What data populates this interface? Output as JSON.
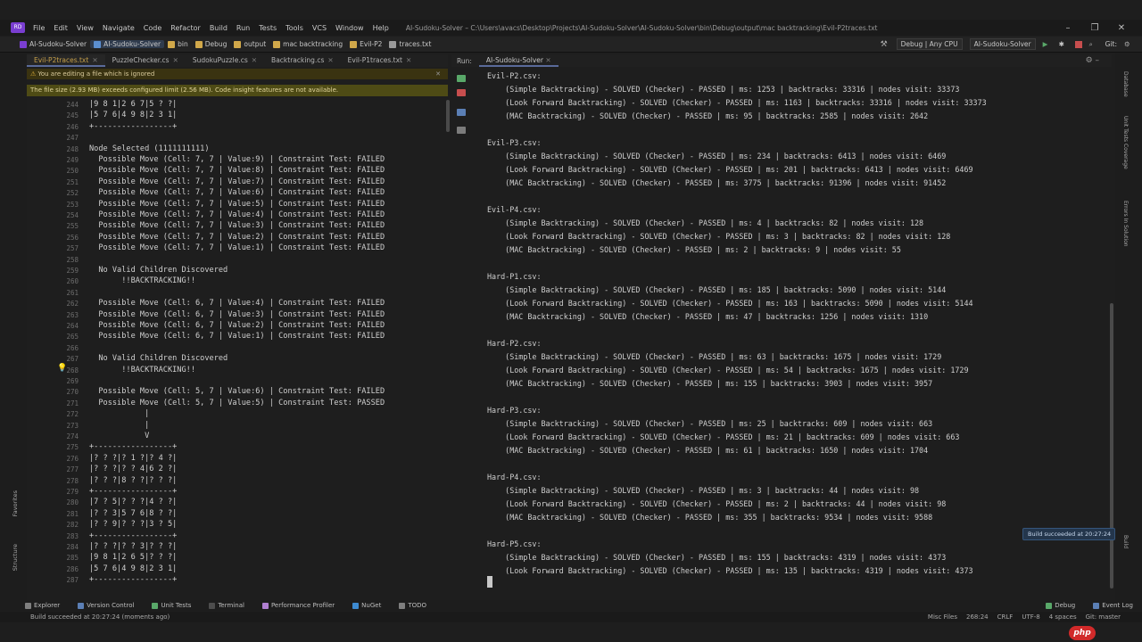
{
  "titlebar": {
    "menus": [
      "File",
      "Edit",
      "View",
      "Navigate",
      "Code",
      "Refactor",
      "Build",
      "Run",
      "Tests",
      "Tools",
      "VCS",
      "Window",
      "Help"
    ],
    "title": "AI-Sudoku-Solver – C:\\Users\\avacs\\Desktop\\Projects\\AI-Sudoku-Solver\\AI-Sudoku-Solver\\bin\\Debug\\output\\mac backtracking\\Evil-P2traces.txt"
  },
  "navbar": {
    "breadcrumbs": [
      "AI-Sudoku-Solver",
      "AI-Sudoku-Solver",
      "bin",
      "Debug",
      "output",
      "mac backtracking",
      "Evil-P2",
      "traces.txt"
    ],
    "config": "Debug | Any CPU",
    "project": "AI-Sudoku-Solver",
    "git": "Git:"
  },
  "editor_tabs": [
    {
      "label": "Evil-P2traces.txt",
      "active": true
    },
    {
      "label": "PuzzleChecker.cs",
      "active": false
    },
    {
      "label": "SudokuPuzzle.cs",
      "active": false
    },
    {
      "label": "Backtracking.cs",
      "active": false
    },
    {
      "label": "Evil-P1traces.txt",
      "active": false
    }
  ],
  "warnings": {
    "ignored": "You are editing a file which is ignored",
    "size": "The file size (2.93 MB) exceeds configured limit (2.56 MB). Code insight features are not available."
  },
  "editor_lines": [
    {
      "n": "244",
      "t": "|9 8 1|2 6 7|5 ? ?|"
    },
    {
      "n": "245",
      "t": "|5 7 6|4 9 8|2 3 1|"
    },
    {
      "n": "246",
      "t": "+-----------------+"
    },
    {
      "n": "247",
      "t": ""
    },
    {
      "n": "248",
      "t": "Node Selected (1111111111)"
    },
    {
      "n": "249",
      "t": "  Possible Move (Cell: 7, 7 | Value:9) | Constraint Test: FAILED"
    },
    {
      "n": "250",
      "t": "  Possible Move (Cell: 7, 7 | Value:8) | Constraint Test: FAILED"
    },
    {
      "n": "251",
      "t": "  Possible Move (Cell: 7, 7 | Value:7) | Constraint Test: FAILED"
    },
    {
      "n": "252",
      "t": "  Possible Move (Cell: 7, 7 | Value:6) | Constraint Test: FAILED"
    },
    {
      "n": "253",
      "t": "  Possible Move (Cell: 7, 7 | Value:5) | Constraint Test: FAILED"
    },
    {
      "n": "254",
      "t": "  Possible Move (Cell: 7, 7 | Value:4) | Constraint Test: FAILED"
    },
    {
      "n": "255",
      "t": "  Possible Move (Cell: 7, 7 | Value:3) | Constraint Test: FAILED"
    },
    {
      "n": "256",
      "t": "  Possible Move (Cell: 7, 7 | Value:2) | Constraint Test: FAILED"
    },
    {
      "n": "257",
      "t": "  Possible Move (Cell: 7, 7 | Value:1) | Constraint Test: FAILED"
    },
    {
      "n": "258",
      "t": ""
    },
    {
      "n": "259",
      "t": "  No Valid Children Discovered"
    },
    {
      "n": "260",
      "t": "       !!BACKTRACKING!!"
    },
    {
      "n": "261",
      "t": ""
    },
    {
      "n": "262",
      "t": "  Possible Move (Cell: 6, 7 | Value:4) | Constraint Test: FAILED"
    },
    {
      "n": "263",
      "t": "  Possible Move (Cell: 6, 7 | Value:3) | Constraint Test: FAILED"
    },
    {
      "n": "264",
      "t": "  Possible Move (Cell: 6, 7 | Value:2) | Constraint Test: FAILED"
    },
    {
      "n": "265",
      "t": "  Possible Move (Cell: 6, 7 | Value:1) | Constraint Test: FAILED"
    },
    {
      "n": "266",
      "t": ""
    },
    {
      "n": "267",
      "t": "  No Valid Children Discovered"
    },
    {
      "n": "268",
      "t": "       !!BACKTRACKING!!"
    },
    {
      "n": "269",
      "t": ""
    },
    {
      "n": "270",
      "t": "  Possible Move (Cell: 5, 7 | Value:6) | Constraint Test: FAILED"
    },
    {
      "n": "271",
      "t": "  Possible Move (Cell: 5, 7 | Value:5) | Constraint Test: PASSED"
    },
    {
      "n": "272",
      "t": "            |"
    },
    {
      "n": "273",
      "t": "            |"
    },
    {
      "n": "274",
      "t": "            V"
    },
    {
      "n": "275",
      "t": "+-----------------+"
    },
    {
      "n": "276",
      "t": "|? ? ?|? 1 ?|? 4 ?|"
    },
    {
      "n": "277",
      "t": "|? ? ?|? ? 4|6 2 ?|"
    },
    {
      "n": "278",
      "t": "|? ? ?|8 ? ?|? ? ?|"
    },
    {
      "n": "279",
      "t": "+-----------------+"
    },
    {
      "n": "280",
      "t": "|7 ? 5|? ? ?|4 ? ?|"
    },
    {
      "n": "281",
      "t": "|? ? 3|5 7 6|8 ? ?|"
    },
    {
      "n": "282",
      "t": "|? ? 9|? ? ?|3 ? 5|"
    },
    {
      "n": "283",
      "t": "+-----------------+"
    },
    {
      "n": "284",
      "t": "|? ? ?|? ? 3|? ? ?|"
    },
    {
      "n": "285",
      "t": "|9 8 1|2 6 5|? ? ?|"
    },
    {
      "n": "286",
      "t": "|5 7 6|4 9 8|2 3 1|"
    },
    {
      "n": "287",
      "t": "+-----------------+"
    }
  ],
  "run_panel": {
    "label": "Run:",
    "tab": "AI-Sudoku-Solver"
  },
  "console_lines": [
    "Evil-P2.csv:",
    "    (Simple Backtracking) - SOLVED (Checker) - PASSED | ms: 1253 | backtracks: 33316 | nodes visit: 33373",
    "    (Look Forward Backtracking) - SOLVED (Checker) - PASSED | ms: 1163 | backtracks: 33316 | nodes visit: 33373",
    "    (MAC Backtracking) - SOLVED (Checker) - PASSED | ms: 95 | backtracks: 2585 | nodes visit: 2642",
    "",
    "Evil-P3.csv:",
    "    (Simple Backtracking) - SOLVED (Checker) - PASSED | ms: 234 | backtracks: 6413 | nodes visit: 6469",
    "    (Look Forward Backtracking) - SOLVED (Checker) - PASSED | ms: 201 | backtracks: 6413 | nodes visit: 6469",
    "    (MAC Backtracking) - SOLVED (Checker) - PASSED | ms: 3775 | backtracks: 91396 | nodes visit: 91452",
    "",
    "Evil-P4.csv:",
    "    (Simple Backtracking) - SOLVED (Checker) - PASSED | ms: 4 | backtracks: 82 | nodes visit: 128",
    "    (Look Forward Backtracking) - SOLVED (Checker) - PASSED | ms: 3 | backtracks: 82 | nodes visit: 128",
    "    (MAC Backtracking) - SOLVED (Checker) - PASSED | ms: 2 | backtracks: 9 | nodes visit: 55",
    "",
    "Hard-P1.csv:",
    "    (Simple Backtracking) - SOLVED (Checker) - PASSED | ms: 185 | backtracks: 5090 | nodes visit: 5144",
    "    (Look Forward Backtracking) - SOLVED (Checker) - PASSED | ms: 163 | backtracks: 5090 | nodes visit: 5144",
    "    (MAC Backtracking) - SOLVED (Checker) - PASSED | ms: 47 | backtracks: 1256 | nodes visit: 1310",
    "",
    "Hard-P2.csv:",
    "    (Simple Backtracking) - SOLVED (Checker) - PASSED | ms: 63 | backtracks: 1675 | nodes visit: 1729",
    "    (Look Forward Backtracking) - SOLVED (Checker) - PASSED | ms: 54 | backtracks: 1675 | nodes visit: 1729",
    "    (MAC Backtracking) - SOLVED (Checker) - PASSED | ms: 155 | backtracks: 3903 | nodes visit: 3957",
    "",
    "Hard-P3.csv:",
    "    (Simple Backtracking) - SOLVED (Checker) - PASSED | ms: 25 | backtracks: 609 | nodes visit: 663",
    "    (Look Forward Backtracking) - SOLVED (Checker) - PASSED | ms: 21 | backtracks: 609 | nodes visit: 663",
    "    (MAC Backtracking) - SOLVED (Checker) - PASSED | ms: 61 | backtracks: 1650 | nodes visit: 1704",
    "",
    "Hard-P4.csv:",
    "    (Simple Backtracking) - SOLVED (Checker) - PASSED | ms: 3 | backtracks: 44 | nodes visit: 98",
    "    (Look Forward Backtracking) - SOLVED (Checker) - PASSED | ms: 2 | backtracks: 44 | nodes visit: 98",
    "    (MAC Backtracking) - SOLVED (Checker) - PASSED | ms: 355 | backtracks: 9534 | nodes visit: 9588",
    "",
    "Hard-P5.csv:",
    "    (Simple Backtracking) - SOLVED (Checker) - PASSED | ms: 155 | backtracks: 4319 | nodes visit: 4373",
    "    (Look Forward Backtracking) - SOLVED (Checker) - PASSED | ms: 135 | backtracks: 4319 | nodes visit: 4373"
  ],
  "toast": "Build succeeded at 20:27:24",
  "tool_tabs": [
    "Explorer",
    "Version Control",
    "Unit Tests",
    "Terminal",
    "Performance Profiler",
    "NuGet",
    "TODO"
  ],
  "tool_tabs_right": [
    "Debug",
    "Event Log"
  ],
  "left_vtabs": [
    "Favorites",
    "Structure"
  ],
  "right_vtabs": [
    "Database",
    "Unit Tests Coverage",
    "Errors In Solution",
    "Build"
  ],
  "status": {
    "message": "Build succeeded at 20:27:24 (moments ago)",
    "misc": "Misc Files",
    "pos": "268:24",
    "eol": "CRLF",
    "encoding": "UTF-8",
    "indent": "4 spaces",
    "branch": "Git: master"
  },
  "watermark": "php"
}
